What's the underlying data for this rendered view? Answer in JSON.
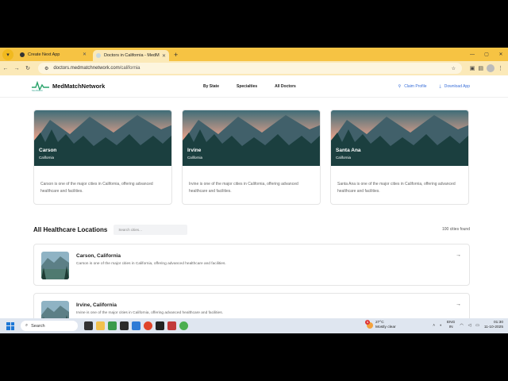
{
  "browser": {
    "tabs": [
      {
        "title": "Create Next App",
        "active": false
      },
      {
        "title": "Doctors in California - MedM",
        "active": true
      }
    ],
    "url_host": "doctors.medmatchnetwork.com",
    "url_path": "/california"
  },
  "site": {
    "logo_text": "MedMatchNetwork",
    "logo_sub": "MedMatch",
    "nav": [
      "By State",
      "Specialties",
      "All Doctors"
    ],
    "claim_profile": "Claim Profile",
    "download_app": "Download App"
  },
  "featured_cards": [
    {
      "title": "Carson",
      "subtitle": "California",
      "description": "Carson is one of the major cities in California, offering advanced healthcare and facilities."
    },
    {
      "title": "Irvine",
      "subtitle": "California",
      "description": "Irvine is one of the major cities in California, offering advanced healthcare and facilities."
    },
    {
      "title": "Santa Ana",
      "subtitle": "California",
      "description": "Santa Ana is one of the major cities in California, offering advanced healthcare and facilities."
    }
  ],
  "locations": {
    "heading": "All Healthcare Locations",
    "search_placeholder": "Search cities...",
    "count": "100 cities found",
    "items": [
      {
        "title": "Carson, California",
        "description": "Carson is one of the major cities in California, offering advanced healthcare and facilities."
      },
      {
        "title": "Irvine, California",
        "description": "Irvine is one of the major cities in California, offering advanced healthcare and facilities."
      }
    ]
  },
  "taskbar": {
    "search_label": "Search",
    "weather_temp": "27°C",
    "weather_desc": "Mostly clear",
    "weather_badge": "1",
    "lang_1": "ENG",
    "lang_2": "IN",
    "time": "01:30",
    "date": "11-10-2025"
  },
  "colors": {
    "tabbar": "#f6c343",
    "accent": "#3a6fd8",
    "taskbar": "#dfe6f0"
  },
  "icons": [
    "chrome-menu-icon",
    "back-icon",
    "forward-icon",
    "reload-icon",
    "site-info-icon",
    "bookmark-star-icon",
    "extensions-icon",
    "profile-icon",
    "kebab-menu-icon",
    "claim-icon",
    "download-icon",
    "arrow-right-icon",
    "windows-start-icon",
    "search-icon",
    "sun-icon",
    "wifi-icon",
    "volume-icon",
    "battery-icon"
  ]
}
